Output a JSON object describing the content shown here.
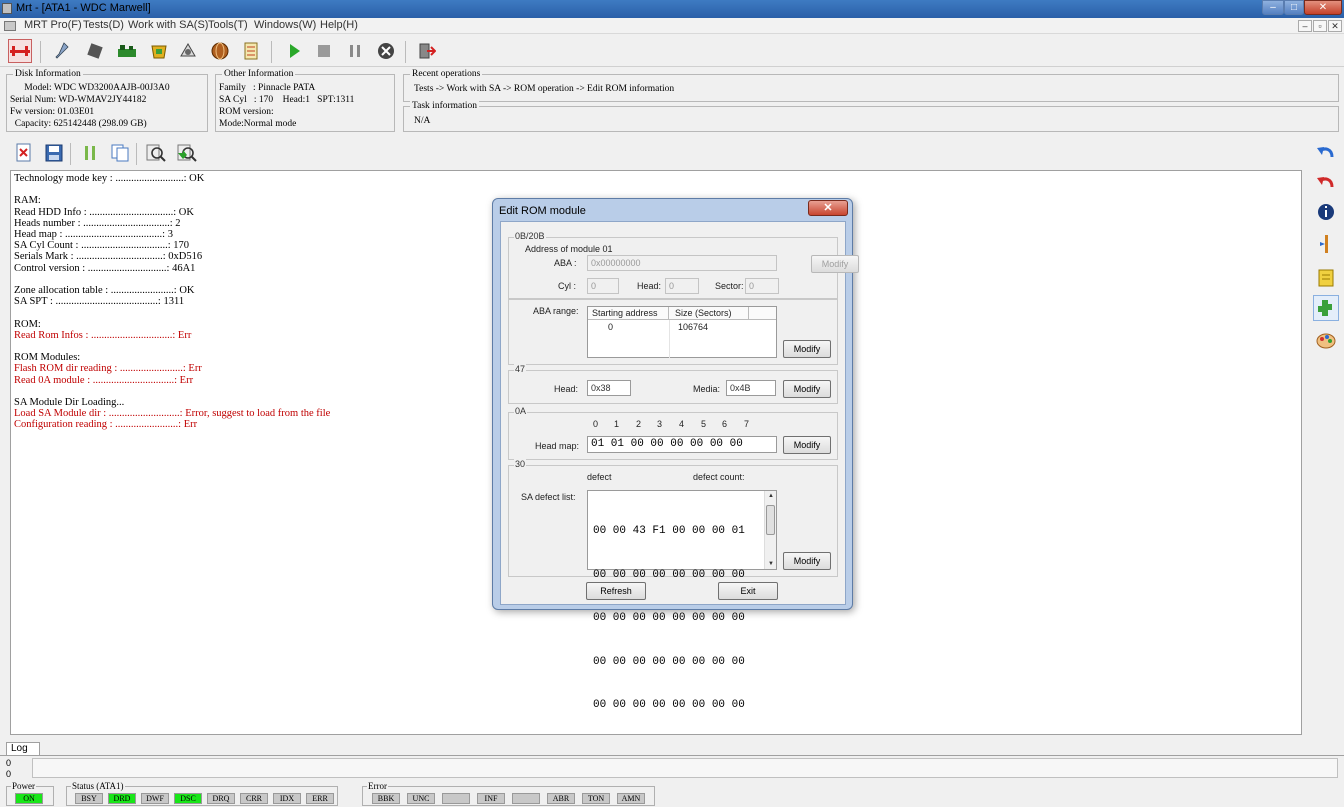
{
  "window": {
    "title": "Mrt - [ATA1 - WDC Marwell]",
    "controls": [
      "–",
      "□",
      "✕"
    ],
    "mdi_controls": [
      "–",
      "▫",
      "✕"
    ]
  },
  "menu": [
    "MRT Pro(F)",
    "Tests(D)",
    "Work with SA(S)",
    "Tools(T)",
    "Windows(W)",
    "Help(H)"
  ],
  "disk_info": {
    "legend": "Disk Information",
    "lines": [
      "      Model: WDC WD3200AAJB-00J3A0",
      "Serial Num: WD-WMAV2JY44182",
      "Fw version: 01.03E01",
      "  Capacity: 625142448 (298.09 GB)"
    ]
  },
  "other_info": {
    "legend": "Other Information",
    "lines": [
      "Family   : Pinnacle PATA",
      "SA Cyl   : 170    Head:1   SPT:1311",
      "ROM version:",
      "Mode:Normal mode"
    ]
  },
  "recent_ops": {
    "legend": "Recent operations",
    "text": "Tests -> Work with SA -> ROM operation -> Edit ROM information"
  },
  "task_info": {
    "legend": "Task information",
    "text": "N/A"
  },
  "log_lines": [
    {
      "t": "Technology mode key : ..........................: OK",
      "err": false
    },
    {
      "t": "",
      "err": false
    },
    {
      "t": "RAM:",
      "err": false
    },
    {
      "t": "Read HDD Info : ................................: OK",
      "err": false
    },
    {
      "t": "Heads number : .................................: 2",
      "err": false
    },
    {
      "t": "Head map : .....................................: 3",
      "err": false
    },
    {
      "t": "SA Cyl Count : .................................: 170",
      "err": false
    },
    {
      "t": "Serials Mark : .................................: 0xD516",
      "err": false
    },
    {
      "t": "Control version : ..............................: 46A1",
      "err": false
    },
    {
      "t": "",
      "err": false
    },
    {
      "t": "Zone allocation table : ........................: OK",
      "err": false
    },
    {
      "t": "SA SPT : .......................................: 1311",
      "err": false
    },
    {
      "t": "",
      "err": false
    },
    {
      "t": "ROM:",
      "err": false
    },
    {
      "t": "Read Rom Infos : ...............................: Err",
      "err": true
    },
    {
      "t": "",
      "err": false
    },
    {
      "t": "ROM Modules:",
      "err": false
    },
    {
      "t": "Flash ROM dir reading : ........................: Err",
      "err": true
    },
    {
      "t": "Read 0A module : ...............................: Err",
      "err": true
    },
    {
      "t": "",
      "err": false
    },
    {
      "t": "SA Module Dir Loading...",
      "err": false
    },
    {
      "t": "Load SA Module dir : ...........................: Error, suggest to load from the file",
      "err": true
    },
    {
      "t": "Configuration reading : ........................: Err",
      "err": true
    }
  ],
  "dialog": {
    "title": "Edit ROM module",
    "close": "✕",
    "f1": {
      "legend": "0B/20B",
      "address_label": "Address of module 01",
      "aba_label": "ABA :",
      "aba_value": "0x00000000",
      "cyl_label": "Cyl :",
      "cyl_value": "0",
      "head_label": "Head:",
      "head_value": "0",
      "sector_label": "Sector:",
      "sector_value": "0",
      "modify": "Modify"
    },
    "aba_range": {
      "label": "ABA range:",
      "columns": [
        "Starting address",
        "Size (Sectors)"
      ],
      "rows": [
        [
          "0",
          "106764"
        ]
      ],
      "modify": "Modify"
    },
    "f47": {
      "legend": "47",
      "head_label": "Head:",
      "head_value": "0x38",
      "media_label": "Media:",
      "media_value": "0x4B",
      "modify": "Modify"
    },
    "f0a": {
      "legend": "0A",
      "indices": [
        "0",
        "1",
        "2",
        "3",
        "4",
        "5",
        "6",
        "7"
      ],
      "headmap_label": "Head map:",
      "headmap_value": "01 01 00 00 00 00 00 00",
      "modify": "Modify"
    },
    "f30": {
      "legend": "30",
      "defect_label": "defect",
      "defect_count_label": "defect count:",
      "list_label": "SA defect list:",
      "rows": [
        "00 00 43 F1 00 00 00 01",
        "00 00 00 00 00 00 00 00",
        "00 00 00 00 00 00 00 00",
        "00 00 00 00 00 00 00 00",
        "00 00 00 00 00 00 00 00"
      ],
      "modify": "Modify"
    },
    "refresh": "Refresh",
    "exit": "Exit"
  },
  "log_tab": "Log",
  "positions": [
    "0",
    "0"
  ],
  "status": {
    "power_legend": "Power",
    "power": [
      {
        "label": "ON",
        "on": true
      }
    ],
    "status_legend": "Status (ATA1)",
    "flags": [
      {
        "label": "BSY",
        "on": false
      },
      {
        "label": "DRD",
        "on": true
      },
      {
        "label": "DWF",
        "on": false
      },
      {
        "label": "DSC",
        "on": true
      },
      {
        "label": "DRQ",
        "on": false
      },
      {
        "label": "CRR",
        "on": false
      },
      {
        "label": "IDX",
        "on": false
      },
      {
        "label": "ERR",
        "on": false
      }
    ],
    "error_legend": "Error",
    "errors": [
      {
        "label": "BBK",
        "on": false
      },
      {
        "label": "UNC",
        "on": false
      },
      {
        "label": "",
        "on": false
      },
      {
        "label": "INF",
        "on": false
      },
      {
        "label": "",
        "on": false
      },
      {
        "label": "ABR",
        "on": false
      },
      {
        "label": "TON",
        "on": false
      },
      {
        "label": "AMN",
        "on": false
      }
    ]
  }
}
